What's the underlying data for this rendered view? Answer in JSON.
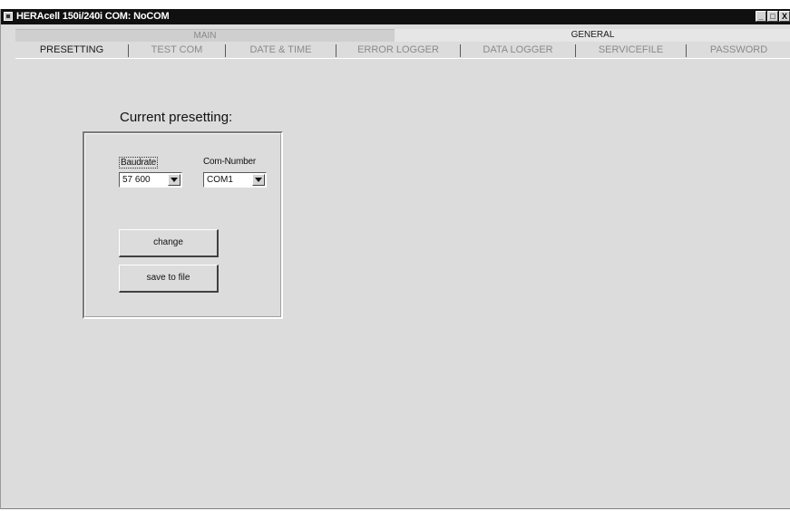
{
  "window": {
    "title": "HERAcell 150i/240i COM: NoCOM",
    "minimize_label": "_",
    "maximize_label": "□",
    "close_label": "X"
  },
  "group_tabs": {
    "main": "MAIN",
    "general": "GENERAL",
    "active": "general"
  },
  "tabs": {
    "presetting": "PRESETTING",
    "test_com": "TEST COM",
    "date_time": "DATE & TIME",
    "error_logger": "ERROR LOGGER",
    "data_logger": "DATA LOGGER",
    "servicefile": "SERVICEFILE",
    "password": "PASSWORD",
    "active": "presetting"
  },
  "presetting": {
    "heading": "Current presetting:",
    "baudrate_label": "Baudrate",
    "baudrate_value": "57 600",
    "com_number_label": "Com-Number",
    "com_number_value": "COM1",
    "change_button": "change",
    "save_button": "save to file"
  },
  "colors": {
    "titlebar": "#101010",
    "window_bg": "#dcdcdc",
    "inactive_text": "#8a8a8a"
  },
  "icons": {
    "app": "app-icon",
    "combo_arrow": "chevron-down-icon"
  }
}
